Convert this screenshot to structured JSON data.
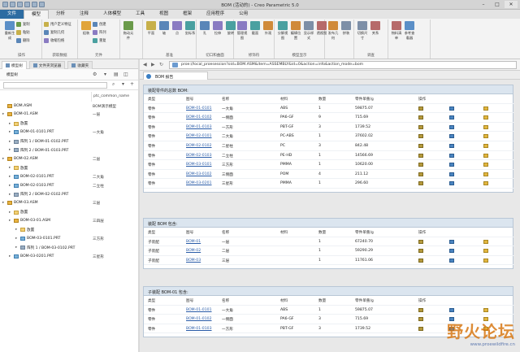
{
  "window": {
    "title": "BOM (活动的) - Creo Parametric 5.0"
  },
  "menu_tabs": [
    "文件",
    "模型",
    "分析",
    "注释",
    "人体模型",
    "工具",
    "视图",
    "框架",
    "应用程序",
    "公用"
  ],
  "ribbon": {
    "groups": [
      {
        "name": "操作",
        "buttons": [
          "重新生成"
        ],
        "small": [
          "复制",
          "粘贴",
          "删除"
        ]
      },
      {
        "name": "获取数据",
        "small": [
          "用户定义特征",
          "复制几何",
          "收缩包络"
        ]
      },
      {
        "name": "元件",
        "buttons": [
          "组装"
        ],
        "small": [
          "创建",
          "阵列",
          "重复"
        ]
      },
      {
        "name": "",
        "buttons": [
          "拖动元件"
        ]
      },
      {
        "name": "基准",
        "buttons": [
          "平面",
          "轴",
          "点",
          "坐标系"
        ]
      },
      {
        "name": "切口和曲面",
        "buttons": [
          "孔",
          "拉伸",
          "旋转"
        ]
      },
      {
        "name": "修饰符",
        "buttons": [
          "管理视图",
          "截面",
          "外观"
        ]
      },
      {
        "name": "模型显示",
        "buttons": [
          "分解视图",
          "编辑位置",
          "显示样式",
          "透视图"
        ]
      },
      {
        "name": "",
        "buttons": [
          "发布几何",
          "拼装"
        ]
      },
      {
        "name": "调查",
        "buttons": [
          "切换尺寸",
          "关系"
        ]
      },
      {
        "name": "",
        "buttons": [
          "物料清单",
          "参考查看器"
        ]
      }
    ]
  },
  "left_panel": {
    "tabs": [
      "模型树",
      "文件夹浏览器",
      "收藏夹"
    ],
    "tree_label": "模型树",
    "col_name": "",
    "col_common": "ptc_common_name",
    "tree": [
      {
        "name": "BOM.ASM",
        "common": "BOM演示模型",
        "level": 0,
        "icon": "asm",
        "exp": ""
      },
      {
        "name": "BOM-01.ASM",
        "common": "一层",
        "level": 0,
        "icon": "asm",
        "exp": "▸"
      },
      {
        "name": "放置",
        "common": "",
        "level": 1,
        "icon": "fld",
        "exp": "▸"
      },
      {
        "name": "BOM-01-0101.PRT",
        "common": "一大角",
        "level": 1,
        "icon": "prt",
        "exp": "▸"
      },
      {
        "name": "阵列 1 / BOM-01-0102.PRT",
        "common": "",
        "level": 1,
        "icon": "arr",
        "exp": "▸"
      },
      {
        "name": "阵列 2 / BOM-01-0103.PRT",
        "common": "",
        "level": 1,
        "icon": "arr",
        "exp": "▸"
      },
      {
        "name": "BOM-02.ASM",
        "common": "二层",
        "level": 0,
        "icon": "asm",
        "exp": "▸"
      },
      {
        "name": "放置",
        "common": "",
        "level": 1,
        "icon": "fld",
        "exp": "▸"
      },
      {
        "name": "BOM-02-0101.PRT",
        "common": "二大角",
        "level": 1,
        "icon": "prt",
        "exp": "▸"
      },
      {
        "name": "BOM-02-0103.PRT",
        "common": "二立柱",
        "level": 1,
        "icon": "prt",
        "exp": "▸"
      },
      {
        "name": "阵列 2 / BOM-02-0102.PRT",
        "common": "",
        "level": 1,
        "icon": "arr",
        "exp": "▸"
      },
      {
        "name": "BOM-03.ASM",
        "common": "三层",
        "level": 0,
        "icon": "asm",
        "exp": "▸"
      },
      {
        "name": "放置",
        "common": "",
        "level": 1,
        "icon": "fld",
        "exp": "▸"
      },
      {
        "name": "BOM-03-01.ASM",
        "common": "三四层",
        "level": 1,
        "icon": "asm",
        "exp": "▸"
      },
      {
        "name": "放置",
        "common": "",
        "level": 2,
        "icon": "fld",
        "exp": "▸"
      },
      {
        "name": "BOM-03-0101.PRT",
        "common": "三方形",
        "level": 2,
        "icon": "prt",
        "exp": "▸"
      },
      {
        "name": "阵列 1 / BOM-03-0102.PRT",
        "common": "",
        "level": 2,
        "icon": "arr",
        "exp": "▸"
      },
      {
        "name": "BOM-03-0201.PRT",
        "common": "三星形",
        "level": 1,
        "icon": "prt",
        "exp": "▸"
      }
    ]
  },
  "browser": {
    "url": "proe://local_proesession?oid=BOM.ASM&item=ASSEMBLY&id=0&action=info&action_mode=bom",
    "tab_title": "BOM 报告"
  },
  "report": {
    "panels": [
      {
        "title": "装配零件的总数 BOM:",
        "headers": [
          "类型",
          "图号",
          "名称",
          "材料",
          "数量",
          "零件单重/g",
          "操作"
        ],
        "rows": [
          [
            "零件",
            "BOM-01-0101",
            "一大角",
            "ABS",
            "1",
            "59875.07"
          ],
          [
            "零件",
            "BOM-01-0102",
            "一侧面",
            "PA6-GF",
            "9",
            "715.69"
          ],
          [
            "零件",
            "BOM-01-0103",
            "一方形",
            "PBT-GF",
            "3",
            "1739.52"
          ],
          [
            "零件",
            "BOM-02-0101",
            "二大角",
            "PC-ABS",
            "1",
            "37602.02"
          ],
          [
            "零件",
            "BOM-02-0102",
            "二星柱",
            "PC",
            "3",
            "842.48"
          ],
          [
            "零件",
            "BOM-02-0103",
            "二立柱",
            "PE-HD",
            "1",
            "14566.69"
          ],
          [
            "零件",
            "BOM-03-0101",
            "三方形",
            "PMMA",
            "1",
            "10620.00"
          ],
          [
            "零件",
            "BOM-03-0102",
            "三侧面",
            "POM",
            "4",
            "211.12"
          ],
          [
            "零件",
            "BOM-03-0201",
            "三星形",
            "PMMA",
            "1",
            "296.60"
          ]
        ]
      },
      {
        "title": "装配 BOM 包含:",
        "headers": [
          "类型",
          "图号",
          "名称",
          "材料",
          "数量",
          "零件单重/g",
          "操作"
        ],
        "rows": [
          [
            "子装配",
            "BOM-01",
            "一层",
            "",
            "1",
            "67240.70"
          ],
          [
            "子装配",
            "BOM-02",
            "二层",
            "",
            "1",
            "59290.29"
          ],
          [
            "子装配",
            "BOM-03",
            "三层",
            "",
            "1",
            "11761.06"
          ]
        ]
      },
      {
        "title": "子装配 BOM-01 包含:",
        "headers": [
          "类型",
          "图号",
          "名称",
          "材料",
          "数量",
          "零件单重/g",
          "操作"
        ],
        "rows": [
          [
            "零件",
            "BOM-01-0101",
            "一大角",
            "ABS",
            "1",
            "59875.07"
          ],
          [
            "零件",
            "BOM-01-0102",
            "一侧面",
            "PA6-GF",
            "3",
            "715.69"
          ],
          [
            "零件",
            "BOM-01-0103",
            "一方形",
            "PBT-GF",
            "3",
            "1739.52"
          ]
        ]
      }
    ]
  },
  "watermark": {
    "text": "野火论坛",
    "url": "www.proewildfire.cn"
  }
}
